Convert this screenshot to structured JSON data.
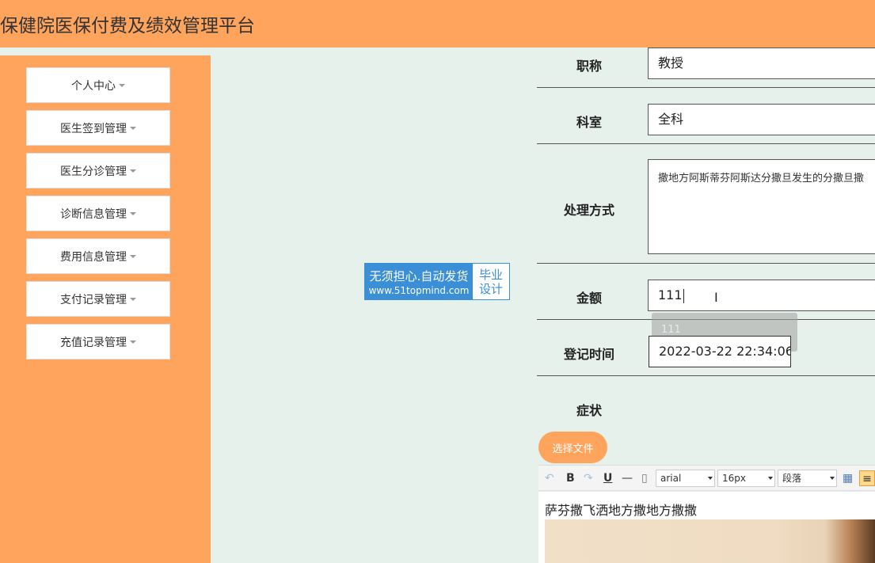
{
  "header": {
    "title": "保健院医保付费及绩效管理平台"
  },
  "sidebar": {
    "items": [
      {
        "label": "个人中心"
      },
      {
        "label": "医生签到管理"
      },
      {
        "label": "医生分诊管理"
      },
      {
        "label": "诊断信息管理"
      },
      {
        "label": "费用信息管理"
      },
      {
        "label": "支付记录管理"
      },
      {
        "label": "充值记录管理"
      }
    ]
  },
  "watermark": {
    "line1": "无须担心.自动发货",
    "line2": "www.51topmind.com",
    "badge1": "毕业",
    "badge2": "设计"
  },
  "form": {
    "title_label": "职称",
    "title_value": "教授",
    "dept_label": "科室",
    "dept_value": "全科",
    "method_label": "处理方式",
    "method_value": "撒地方阿斯蒂芬阿斯达分撒旦发生的分撒旦撒",
    "amount_label": "金额",
    "amount_value": "111",
    "amount_suggestion": "111",
    "time_label": "登记时间",
    "time_value": "2022-03-22 22:34:06",
    "symptom_label": "症状",
    "file_button": "选择文件"
  },
  "toolbar": {
    "bold": "B",
    "underline": "U",
    "hr": "—",
    "font_family": "arial",
    "font_size": "16px",
    "paragraph": "段落"
  },
  "editor": {
    "content": "萨芬撒飞洒地方撒地方撒撒"
  }
}
